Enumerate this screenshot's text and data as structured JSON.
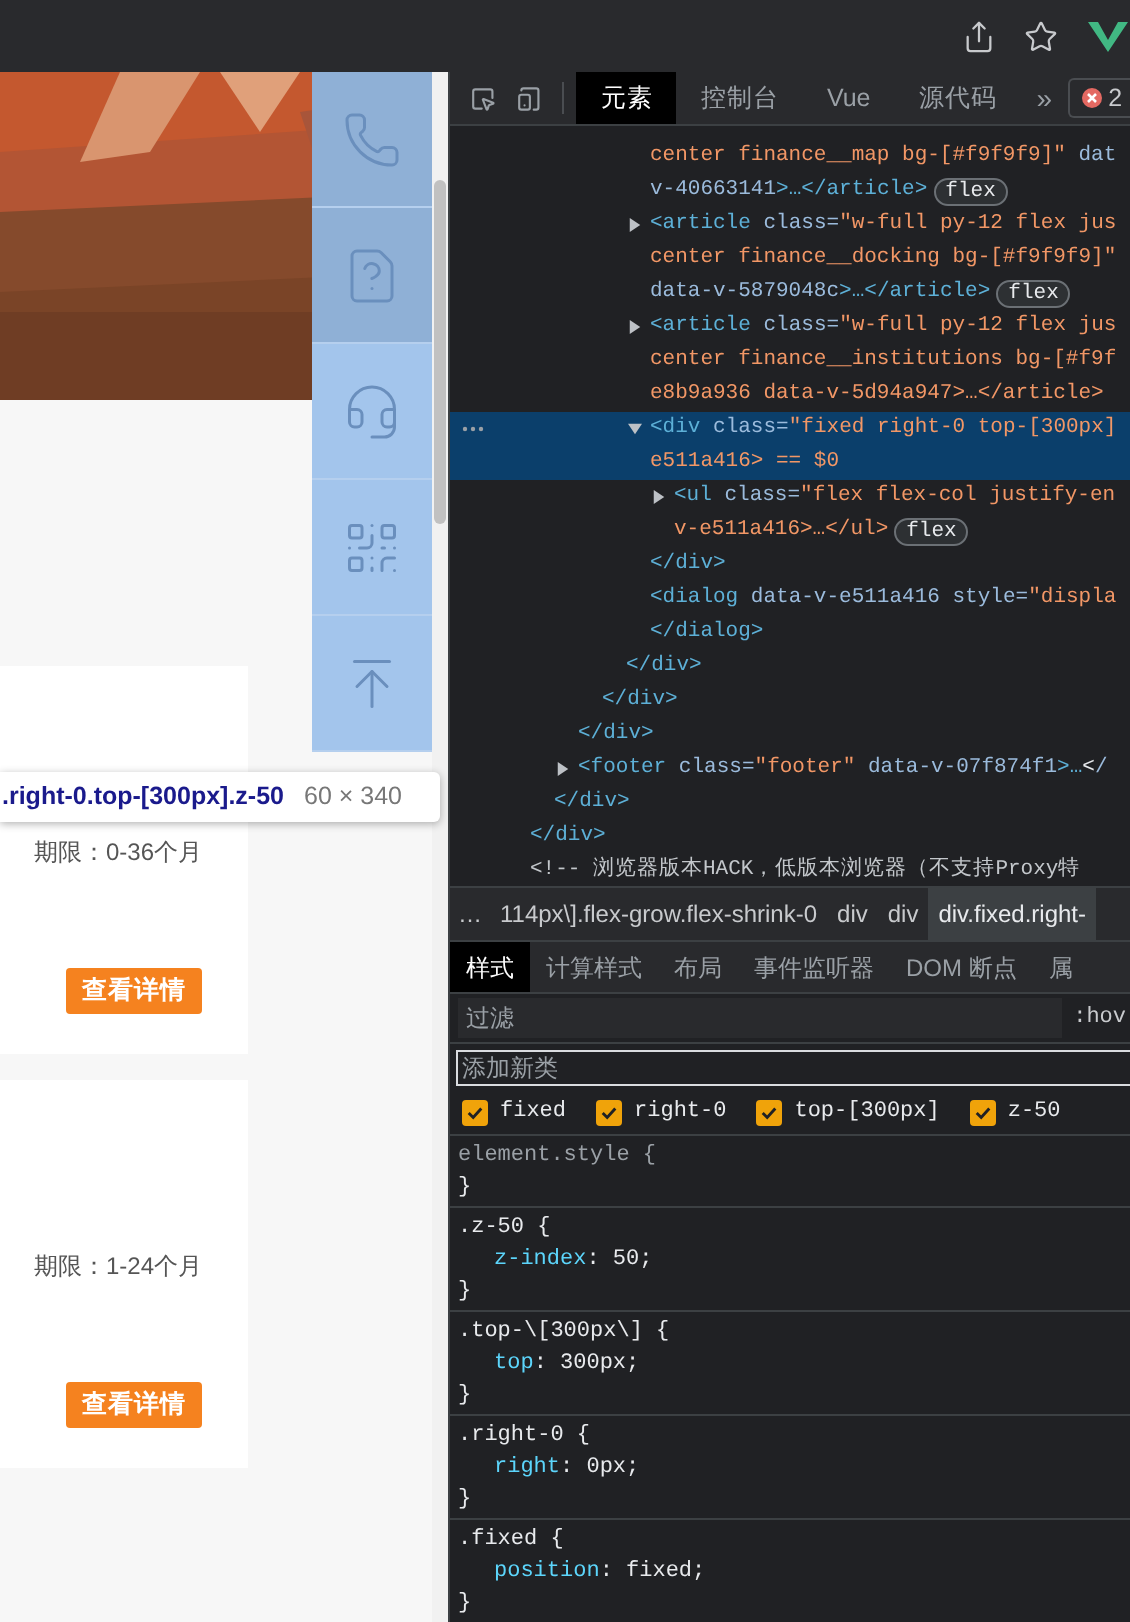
{
  "page": {
    "cards": [
      {
        "term": "期限：0-36个月",
        "button": "查看详情"
      },
      {
        "term": "期限：1-24个月",
        "button": "查看详情"
      }
    ],
    "tooltip": {
      "selector": ".right-0.top-[300px].z-50",
      "size": "60 × 340"
    }
  },
  "devtools": {
    "tabs": [
      {
        "label": "元素",
        "selected": true
      },
      {
        "label": "控制台",
        "selected": false
      },
      {
        "label": "Vue",
        "selected": false
      },
      {
        "label": "源代码",
        "selected": false
      }
    ],
    "more": "»",
    "error_count": "2",
    "dom_tree": [
      {
        "kind": "element",
        "selected": false,
        "closing": "</div>",
        "children": [
          {
            "kind": "element",
            "selected": false,
            "closing": "</div>",
            "children": [
              {
                "kind": "element",
                "selected": false,
                "closing": "</div>",
                "children": [
                  {
                    "kind": "element",
                    "selected": false,
                    "closing": "</div>",
                    "children": [
                      {
                        "kind": "element",
                        "selected": false,
                        "closing": "</div>",
                        "children": [
                          {
                            "kind": "element",
                            "selected": false,
                            "continued": true,
                            "lines": [
                              "center finance__map bg-[#f9f9f9]\" dat",
                              "v-40663141>…</article>"
                            ],
                            "badge": "flex"
                          },
                          {
                            "kind": "element",
                            "selected": false,
                            "expanded": false,
                            "lines": [
                              "<article class=\"w-full py-12 flex jus",
                              "center finance__docking bg-[#f9f9f9]\"",
                              "data-v-5879048c>…</article>"
                            ],
                            "badge": "flex"
                          },
                          {
                            "kind": "element",
                            "selected": false,
                            "expanded": false,
                            "lines": [
                              "<article class=\"w-full py-12 flex jus",
                              "center finance__institutions bg-[#f9f",
                              "e8b9a936 data-v-5d94a947>…</article>"
                            ]
                          },
                          {
                            "kind": "element",
                            "selected": true,
                            "expanded": true,
                            "lines": [
                              "<div class=\"fixed right-0 top-[300px]",
                              "e511a416> == $0"
                            ],
                            "closing": "</div>",
                            "children": [
                              {
                                "kind": "element",
                                "selected": false,
                                "expanded": false,
                                "lines": [
                                  "<ul class=\"flex flex-col justify-en",
                                  "v-e511a416>…</ul>"
                                ],
                                "badge": "flex"
                              }
                            ]
                          },
                          {
                            "kind": "element",
                            "selected": false,
                            "lines": [
                              "<dialog data-v-e511a416 style=\"displa"
                            ],
                            "closing": "</dialog>"
                          }
                        ]
                      }
                    ]
                  }
                ]
              },
              {
                "kind": "element",
                "selected": false,
                "expanded": false,
                "lines": [
                  "<footer class=\"footer\" data-v-07f874f1>…</"
                ]
              }
            ]
          }
        ]
      },
      {
        "kind": "comment",
        "selected": false,
        "lines": [
          "<!-- 浏览器版本HACK，低版本浏览器（不支持Proxy特"
        ]
      }
    ],
    "breadcrumb": {
      "overflow": "…",
      "items": [
        {
          "label": "114px\\].flex-grow.flex-shrink-0",
          "selected": false
        },
        {
          "label": "div",
          "selected": false
        },
        {
          "label": "div",
          "selected": false
        },
        {
          "label": "div.fixed.right-",
          "selected": true
        }
      ]
    },
    "style_tabs": [
      {
        "label": "样式",
        "selected": true
      },
      {
        "label": "计算样式",
        "selected": false
      },
      {
        "label": "布局",
        "selected": false
      },
      {
        "label": "事件监听器",
        "selected": false
      },
      {
        "label": "DOM 断点",
        "selected": false
      },
      {
        "label": "属",
        "selected": false
      }
    ],
    "filter": {
      "placeholder": "过滤"
    },
    "hov": ":hov",
    "class_field": {
      "placeholder": "添加新类"
    },
    "classes": [
      {
        "label": "fixed",
        "checked": true
      },
      {
        "label": "right-0",
        "checked": true
      },
      {
        "label": "top-[300px]",
        "checked": true
      },
      {
        "label": "z-50",
        "checked": true
      }
    ],
    "rules": [
      {
        "kind": "inline",
        "header": "element.style {",
        "close": "}"
      },
      {
        "kind": "class",
        "header": ".z-50 {",
        "declarations": [
          "z-index: 50;"
        ],
        "close": "}"
      },
      {
        "kind": "class",
        "header": ".top-\\[300px\\] {",
        "declarations": [
          "top: 300px;"
        ],
        "close": "}"
      },
      {
        "kind": "class",
        "header": ".right-0 {",
        "declarations": [
          "right: 0px;"
        ],
        "close": "}"
      },
      {
        "kind": "class",
        "header": ".fixed {",
        "declarations": [
          "position: fixed;"
        ],
        "close": "}"
      }
    ]
  }
}
